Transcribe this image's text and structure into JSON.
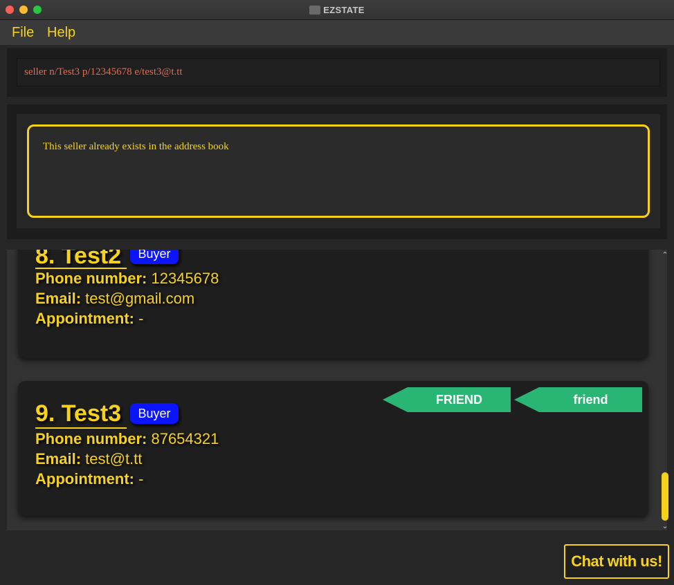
{
  "window": {
    "title": "EZSTATE"
  },
  "menu": {
    "file": "File",
    "help": "Help"
  },
  "command": {
    "value": "seller n/Test3 p/12345678 e/test3@t.tt"
  },
  "result": {
    "message": "This seller already exists in the address book"
  },
  "persons": [
    {
      "title": "8. Test2",
      "role": "Buyer",
      "phone_label": "Phone number:",
      "phone": "12345678",
      "email_label": "Email:",
      "email": "test@gmail.com",
      "appt_label": "Appointment:",
      "appt": "-"
    },
    {
      "title": "9. Test3",
      "role": "Buyer",
      "phone_label": "Phone number:",
      "phone": "87654321",
      "email_label": "Email:",
      "email": "test@t.tt",
      "appt_label": "Appointment:",
      "appt": "-",
      "tags": [
        "FRIEND",
        "friend"
      ]
    }
  ],
  "chat": {
    "label": "Chat with us!"
  },
  "colors": {
    "accent": "#f7d21b",
    "tag": "#29b674",
    "badge": "#0a14ff",
    "error_text": "#e46b57"
  }
}
